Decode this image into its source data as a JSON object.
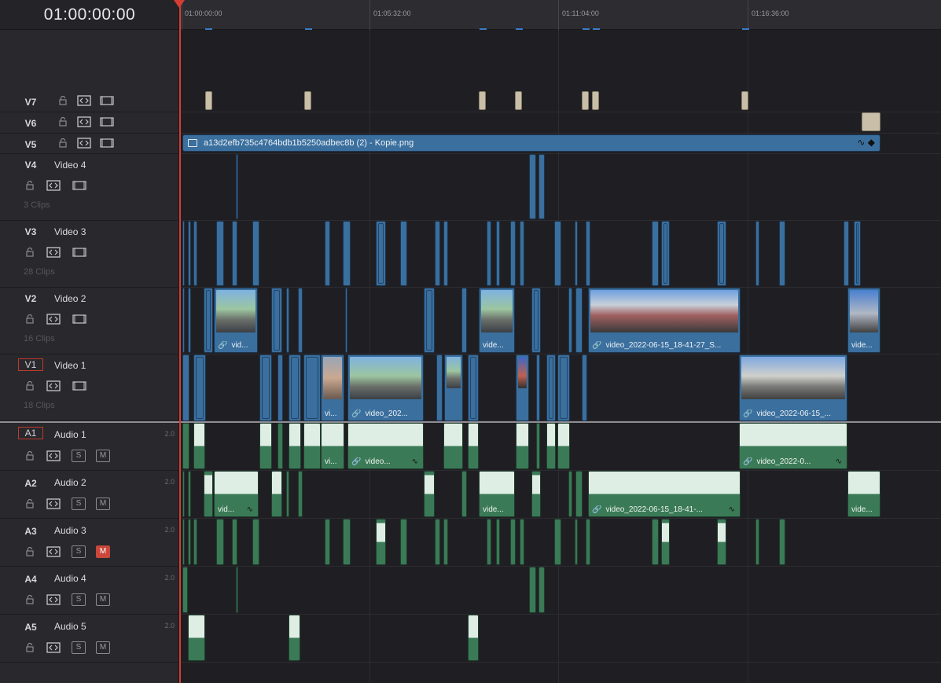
{
  "timecode": "01:00:00:00",
  "ruler": {
    "labels": [
      "01:00:00:00",
      "01:05:32:00",
      "01:11:04:00",
      "01:16:36:00"
    ]
  },
  "tracks": {
    "v7": {
      "id": "V7"
    },
    "v6": {
      "id": "V6"
    },
    "v5": {
      "id": "V5",
      "clip_name": "a13d2efb735c4764bdb1b5250adbec8b (2) - Kopie.png"
    },
    "v4": {
      "id": "V4",
      "name": "Video 4",
      "count": "3 Clips"
    },
    "v3": {
      "id": "V3",
      "name": "Video 3",
      "count": "28 Clips"
    },
    "v2": {
      "id": "V2",
      "name": "Video 2",
      "count": "16 Clips"
    },
    "v1": {
      "id": "V1",
      "name": "Video 1",
      "count": "18 Clips"
    },
    "a1": {
      "id": "A1",
      "name": "Audio 1",
      "channels": "2.0"
    },
    "a2": {
      "id": "A2",
      "name": "Audio 2",
      "channels": "2.0"
    },
    "a3": {
      "id": "A3",
      "name": "Audio 3",
      "channels": "2.0"
    },
    "a4": {
      "id": "A4",
      "name": "Audio 4",
      "channels": "2.0"
    },
    "a5": {
      "id": "A5",
      "name": "Audio 5",
      "channels": "2.0"
    }
  },
  "buttons": {
    "solo": "S",
    "mute": "M"
  },
  "clips": {
    "v2_a": "vid...",
    "v2_b": "vide...",
    "v2_c": "video_2022-06-15_18-41-27_S...",
    "v2_d": "vide...",
    "v1_a": "vi...",
    "v1_b": "video_202...",
    "v1_c": "video_2022-06-15_...",
    "a1_a": "vi...",
    "a1_b": "video...",
    "a1_c": "video_2022-0...",
    "a2_a": "vid...",
    "a2_b": "vide...",
    "a2_c": "video_2022-06-15_18-41-...",
    "a2_d": "vide..."
  },
  "icons": {
    "lock": "lock-icon",
    "auto_select": "auto-select-icon",
    "monitor": "monitor-icon",
    "link": "link-icon",
    "image": "image-icon",
    "fade": "fade-curve-icon",
    "keyframe": "keyframe-icon"
  },
  "colors": {
    "video_clip": "#3a6f9e",
    "audio_clip": "#3b7a57",
    "playhead": "#d43d33",
    "armed_border": "#c03a2b",
    "mute_on": "#c9473b"
  },
  "state": {
    "a3_muted": true,
    "v1_armed": true,
    "a1_armed": true
  }
}
